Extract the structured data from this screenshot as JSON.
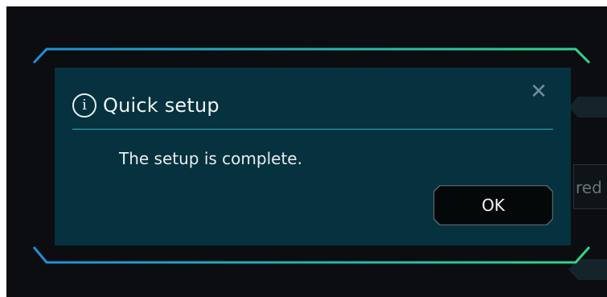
{
  "background": {
    "partial_field_text": "red"
  },
  "dialog": {
    "title": "Quick setup",
    "message": "The setup is complete.",
    "close_icon": "close-icon",
    "info_icon": "info-icon",
    "ok_label": "OK"
  },
  "colors": {
    "backdrop": "#0b0d10",
    "dialog_bg": "#06313e",
    "divider": "#23b9c9",
    "frame_left": "#1f8fd8",
    "frame_right": "#2fd68a",
    "button_bg": "#050809",
    "button_border": "#5a6469"
  }
}
